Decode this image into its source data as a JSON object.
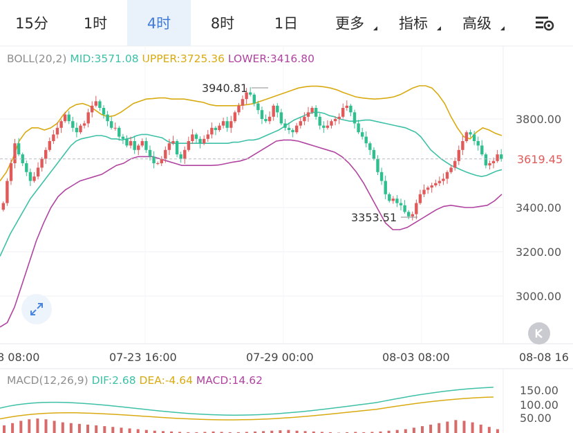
{
  "tabs": [
    {
      "label": "15分",
      "active": false,
      "dropdown": false
    },
    {
      "label": "1时",
      "active": false,
      "dropdown": false
    },
    {
      "label": "4时",
      "active": true,
      "dropdown": false
    },
    {
      "label": "8时",
      "active": false,
      "dropdown": false
    },
    {
      "label": "1日",
      "active": false,
      "dropdown": false
    },
    {
      "label": "更多",
      "active": false,
      "dropdown": true
    },
    {
      "label": "指标",
      "active": false,
      "dropdown": true
    },
    {
      "label": "高级",
      "active": false,
      "dropdown": true
    }
  ],
  "settings_icon": "chart-settings-icon",
  "boll": {
    "label": "BOLL(20,2)",
    "mid": "MID:3571.08",
    "upper": "UPPER:3725.36",
    "lower": "LOWER:3416.80"
  },
  "macd": {
    "label": "MACD(12,26,9)",
    "dif": "DIF:2.68",
    "dea": "DEA:-4.64",
    "macd": "MACD:14.62"
  },
  "colors": {
    "up": "#e05a5a",
    "down": "#2fbf8f",
    "mid": "#3cc0a6",
    "upper": "#d9aa10",
    "lower": "#b043a0",
    "accent": "#3f7bd9"
  },
  "chart_data": {
    "type": "candlestick",
    "price_axis": {
      "min": 2840,
      "max": 4030,
      "ticks": [
        3800,
        3400,
        3200,
        3000
      ],
      "tick_labels": [
        "3800.00",
        "3400.00",
        "3200.00",
        "3000.00"
      ]
    },
    "time_labels": [
      "8 08:00",
      "07-23 16:00",
      "07-29 00:00",
      "08-03 08:00",
      "08-08 16"
    ],
    "current_price": "3619.45",
    "max_annotation": "3940.81",
    "min_annotation": "3353.51",
    "macd_axis": {
      "ticks": [
        150,
        100,
        50
      ],
      "tick_labels": [
        "150.00",
        "100.00",
        "50.00"
      ]
    },
    "close": [
      3420,
      3520,
      3600,
      3690,
      3640,
      3600,
      3560,
      3520,
      3540,
      3580,
      3620,
      3660,
      3700,
      3730,
      3760,
      3790,
      3820,
      3790,
      3760,
      3740,
      3770,
      3780,
      3830,
      3860,
      3880,
      3850,
      3820,
      3790,
      3760,
      3760,
      3720,
      3710,
      3680,
      3700,
      3660,
      3680,
      3700,
      3660,
      3630,
      3600,
      3600,
      3620,
      3660,
      3690,
      3700,
      3640,
      3620,
      3660,
      3700,
      3730,
      3710,
      3690,
      3710,
      3730,
      3760,
      3750,
      3770,
      3790,
      3760,
      3790,
      3830,
      3860,
      3890,
      3920,
      3910,
      3870,
      3840,
      3800,
      3790,
      3810,
      3860,
      3830,
      3780,
      3760,
      3750,
      3740,
      3770,
      3790,
      3810,
      3830,
      3850,
      3810,
      3770,
      3760,
      3770,
      3790,
      3800,
      3810,
      3850,
      3860,
      3830,
      3780,
      3740,
      3720,
      3690,
      3660,
      3620,
      3560,
      3520,
      3460,
      3430,
      3440,
      3420,
      3410,
      3380,
      3360,
      3370,
      3420,
      3460,
      3480,
      3490,
      3500,
      3510,
      3520,
      3530,
      3560,
      3580,
      3610,
      3660,
      3700,
      3740,
      3730,
      3700,
      3680,
      3640,
      3590,
      3600,
      3610,
      3640,
      3620
    ],
    "mid": [
      3180,
      3230,
      3280,
      3320,
      3360,
      3400,
      3440,
      3470,
      3500,
      3530,
      3560,
      3590,
      3620,
      3650,
      3680,
      3700,
      3710,
      3715,
      3720,
      3725,
      3725,
      3720,
      3710,
      3710,
      3705,
      3710,
      3715,
      3725,
      3730,
      3730,
      3725,
      3720,
      3715,
      3700,
      3690,
      3690,
      3690,
      3690,
      3690,
      3690,
      3690,
      3690,
      3690,
      3690,
      3690,
      3690,
      3695,
      3695,
      3700,
      3705,
      3705,
      3710,
      3720,
      3730,
      3740,
      3750,
      3765,
      3780,
      3795,
      3805,
      3815,
      3825,
      3830,
      3830,
      3825,
      3815,
      3810,
      3800,
      3795,
      3790,
      3790,
      3792,
      3795,
      3795,
      3790,
      3785,
      3780,
      3775,
      3770,
      3765,
      3760,
      3750,
      3740,
      3720,
      3690,
      3660,
      3640,
      3620,
      3605,
      3590,
      3580,
      3570,
      3560,
      3552,
      3545,
      3540,
      3545,
      3555,
      3565,
      3571
    ],
    "upper": [
      3520,
      3560,
      3620,
      3700,
      3740,
      3760,
      3760,
      3750,
      3760,
      3780,
      3820,
      3850,
      3865,
      3870,
      3860,
      3840,
      3820,
      3810,
      3815,
      3830,
      3850,
      3870,
      3880,
      3890,
      3892,
      3895,
      3895,
      3890,
      3890,
      3890,
      3885,
      3880,
      3875,
      3865,
      3860,
      3860,
      3860,
      3860,
      3862,
      3865,
      3870,
      3880,
      3890,
      3900,
      3910,
      3920,
      3930,
      3940,
      3945,
      3948,
      3948,
      3945,
      3940,
      3932,
      3920,
      3910,
      3900,
      3895,
      3892,
      3890,
      3892,
      3895,
      3900,
      3910,
      3925,
      3940,
      3950,
      3950,
      3940,
      3910,
      3870,
      3810,
      3760,
      3720,
      3710,
      3740,
      3760,
      3750,
      3735,
      3725
    ],
    "lower": [
      2860,
      2880,
      2950,
      3050,
      3150,
      3250,
      3330,
      3400,
      3450,
      3480,
      3500,
      3520,
      3530,
      3540,
      3550,
      3570,
      3590,
      3600,
      3620,
      3630,
      3630,
      3630,
      3620,
      3610,
      3600,
      3590,
      3590,
      3590,
      3590,
      3590,
      3592,
      3598,
      3605,
      3610,
      3620,
      3640,
      3660,
      3680,
      3700,
      3705,
      3705,
      3700,
      3690,
      3680,
      3670,
      3660,
      3650,
      3630,
      3600,
      3560,
      3510,
      3450,
      3390,
      3330,
      3300,
      3300,
      3310,
      3330,
      3350,
      3370,
      3390,
      3405,
      3410,
      3405,
      3400,
      3400,
      3405,
      3410,
      3430,
      3460
    ],
    "macd_hist": [
      20,
      26,
      32,
      36,
      38,
      36,
      32,
      28,
      26,
      24,
      22,
      20,
      18,
      16,
      14,
      12,
      10,
      8,
      6,
      5,
      4,
      3,
      2,
      2,
      3,
      4,
      3,
      2,
      2,
      3,
      4,
      5,
      6,
      7,
      8,
      6,
      5,
      4,
      3,
      2,
      1,
      2,
      3,
      2,
      3,
      4,
      6,
      8,
      10,
      14,
      18,
      22,
      26,
      30,
      34,
      32,
      28,
      22,
      16,
      10
    ]
  }
}
